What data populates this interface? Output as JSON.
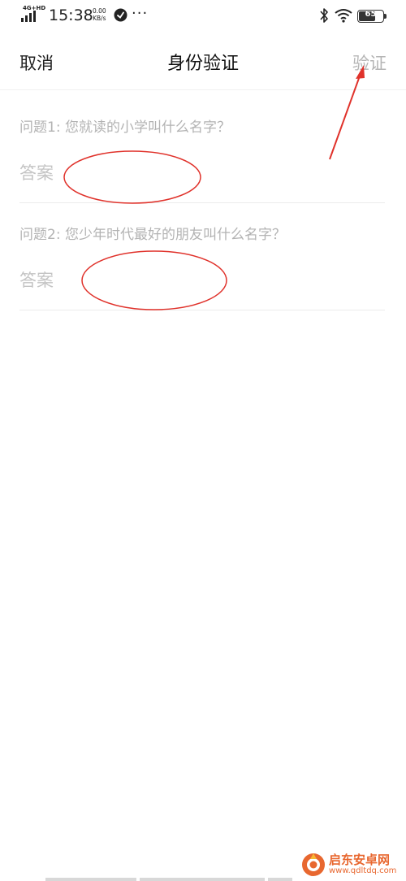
{
  "status_bar": {
    "network": "4G+HD",
    "time": "15:38",
    "speed_value": "0.00",
    "speed_unit": "KB/s",
    "more": "···",
    "battery": "65",
    "icons": [
      "signal-icon",
      "clock-badge-icon",
      "bluetooth-icon",
      "wifi-icon",
      "battery-icon"
    ]
  },
  "nav": {
    "cancel_label": "取消",
    "title": "身份验证",
    "verify_label": "验证"
  },
  "questions": [
    {
      "label": "问题1: 您就读的小学叫什么名字？",
      "answer_placeholder": "答案",
      "answer_value": ""
    },
    {
      "label": "问题2: 您少年时代最好的朋友叫什么名字？",
      "answer_placeholder": "答案",
      "answer_value": ""
    }
  ],
  "watermark": {
    "name": "启东安卓网",
    "url": "www.qdltdq.com"
  },
  "colors": {
    "annotation_red": "#e0322b",
    "disabled_text": "#b5b5b5",
    "watermark_orange": "#e8672f"
  }
}
